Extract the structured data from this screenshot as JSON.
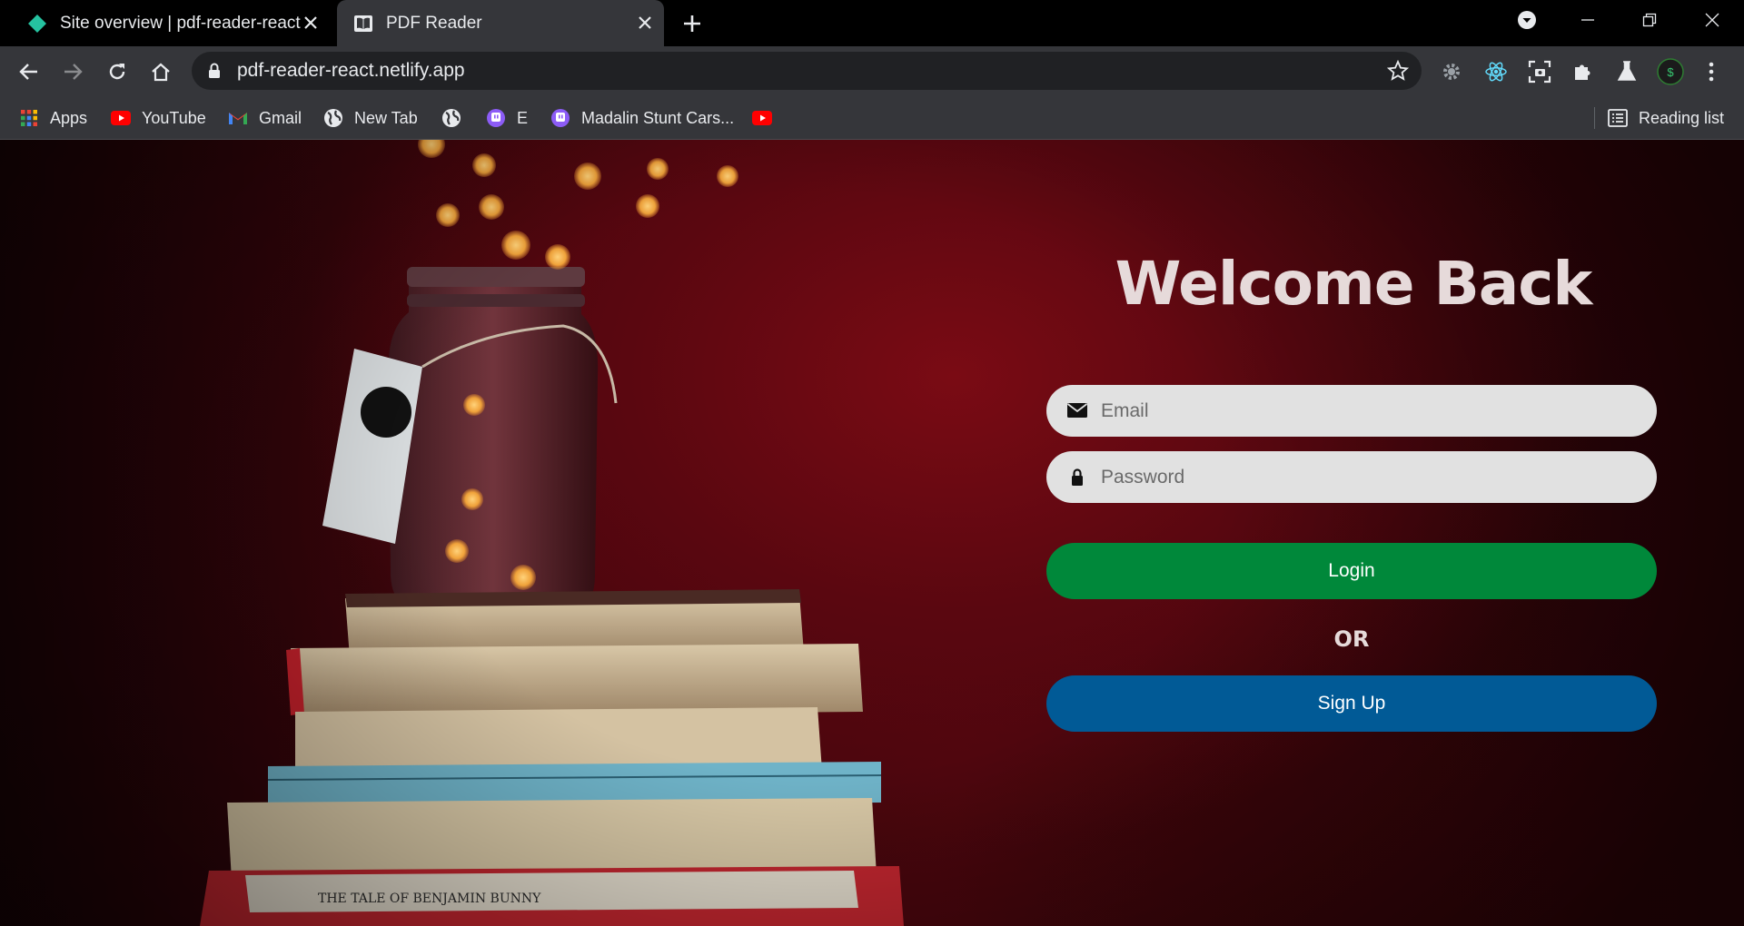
{
  "tabs": [
    {
      "label": "Site overview | pdf-reader-react",
      "icon": "netlify-diamond-icon"
    },
    {
      "label": "PDF Reader",
      "icon": "book-icon",
      "active": true
    }
  ],
  "omnibox": {
    "url": "pdf-reader-react.netlify.app"
  },
  "bookmarks": [
    {
      "label": "Apps",
      "icon": "apps-grid-icon"
    },
    {
      "label": "YouTube",
      "icon": "youtube-icon"
    },
    {
      "label": "Gmail",
      "icon": "gmail-icon"
    },
    {
      "label": "New Tab",
      "icon": "globe-icon"
    },
    {
      "label": "",
      "icon": "globe-icon"
    },
    {
      "label": "E",
      "icon": "twitch-icon"
    },
    {
      "label": "Madalin Stunt Cars...",
      "icon": "twitch-icon"
    },
    {
      "label": "",
      "icon": "youtube-icon"
    }
  ],
  "reading_list": {
    "label": "Reading list"
  },
  "login": {
    "title": "Welcome Back",
    "email_placeholder": "Email",
    "password_placeholder": "Password",
    "login_label": "Login",
    "or_label": "OR",
    "signup_label": "Sign Up"
  },
  "colors": {
    "login_button": "#00883a",
    "signup_button": "#015a96",
    "field_bg": "#e1e1e1",
    "background": "#4a060d"
  }
}
